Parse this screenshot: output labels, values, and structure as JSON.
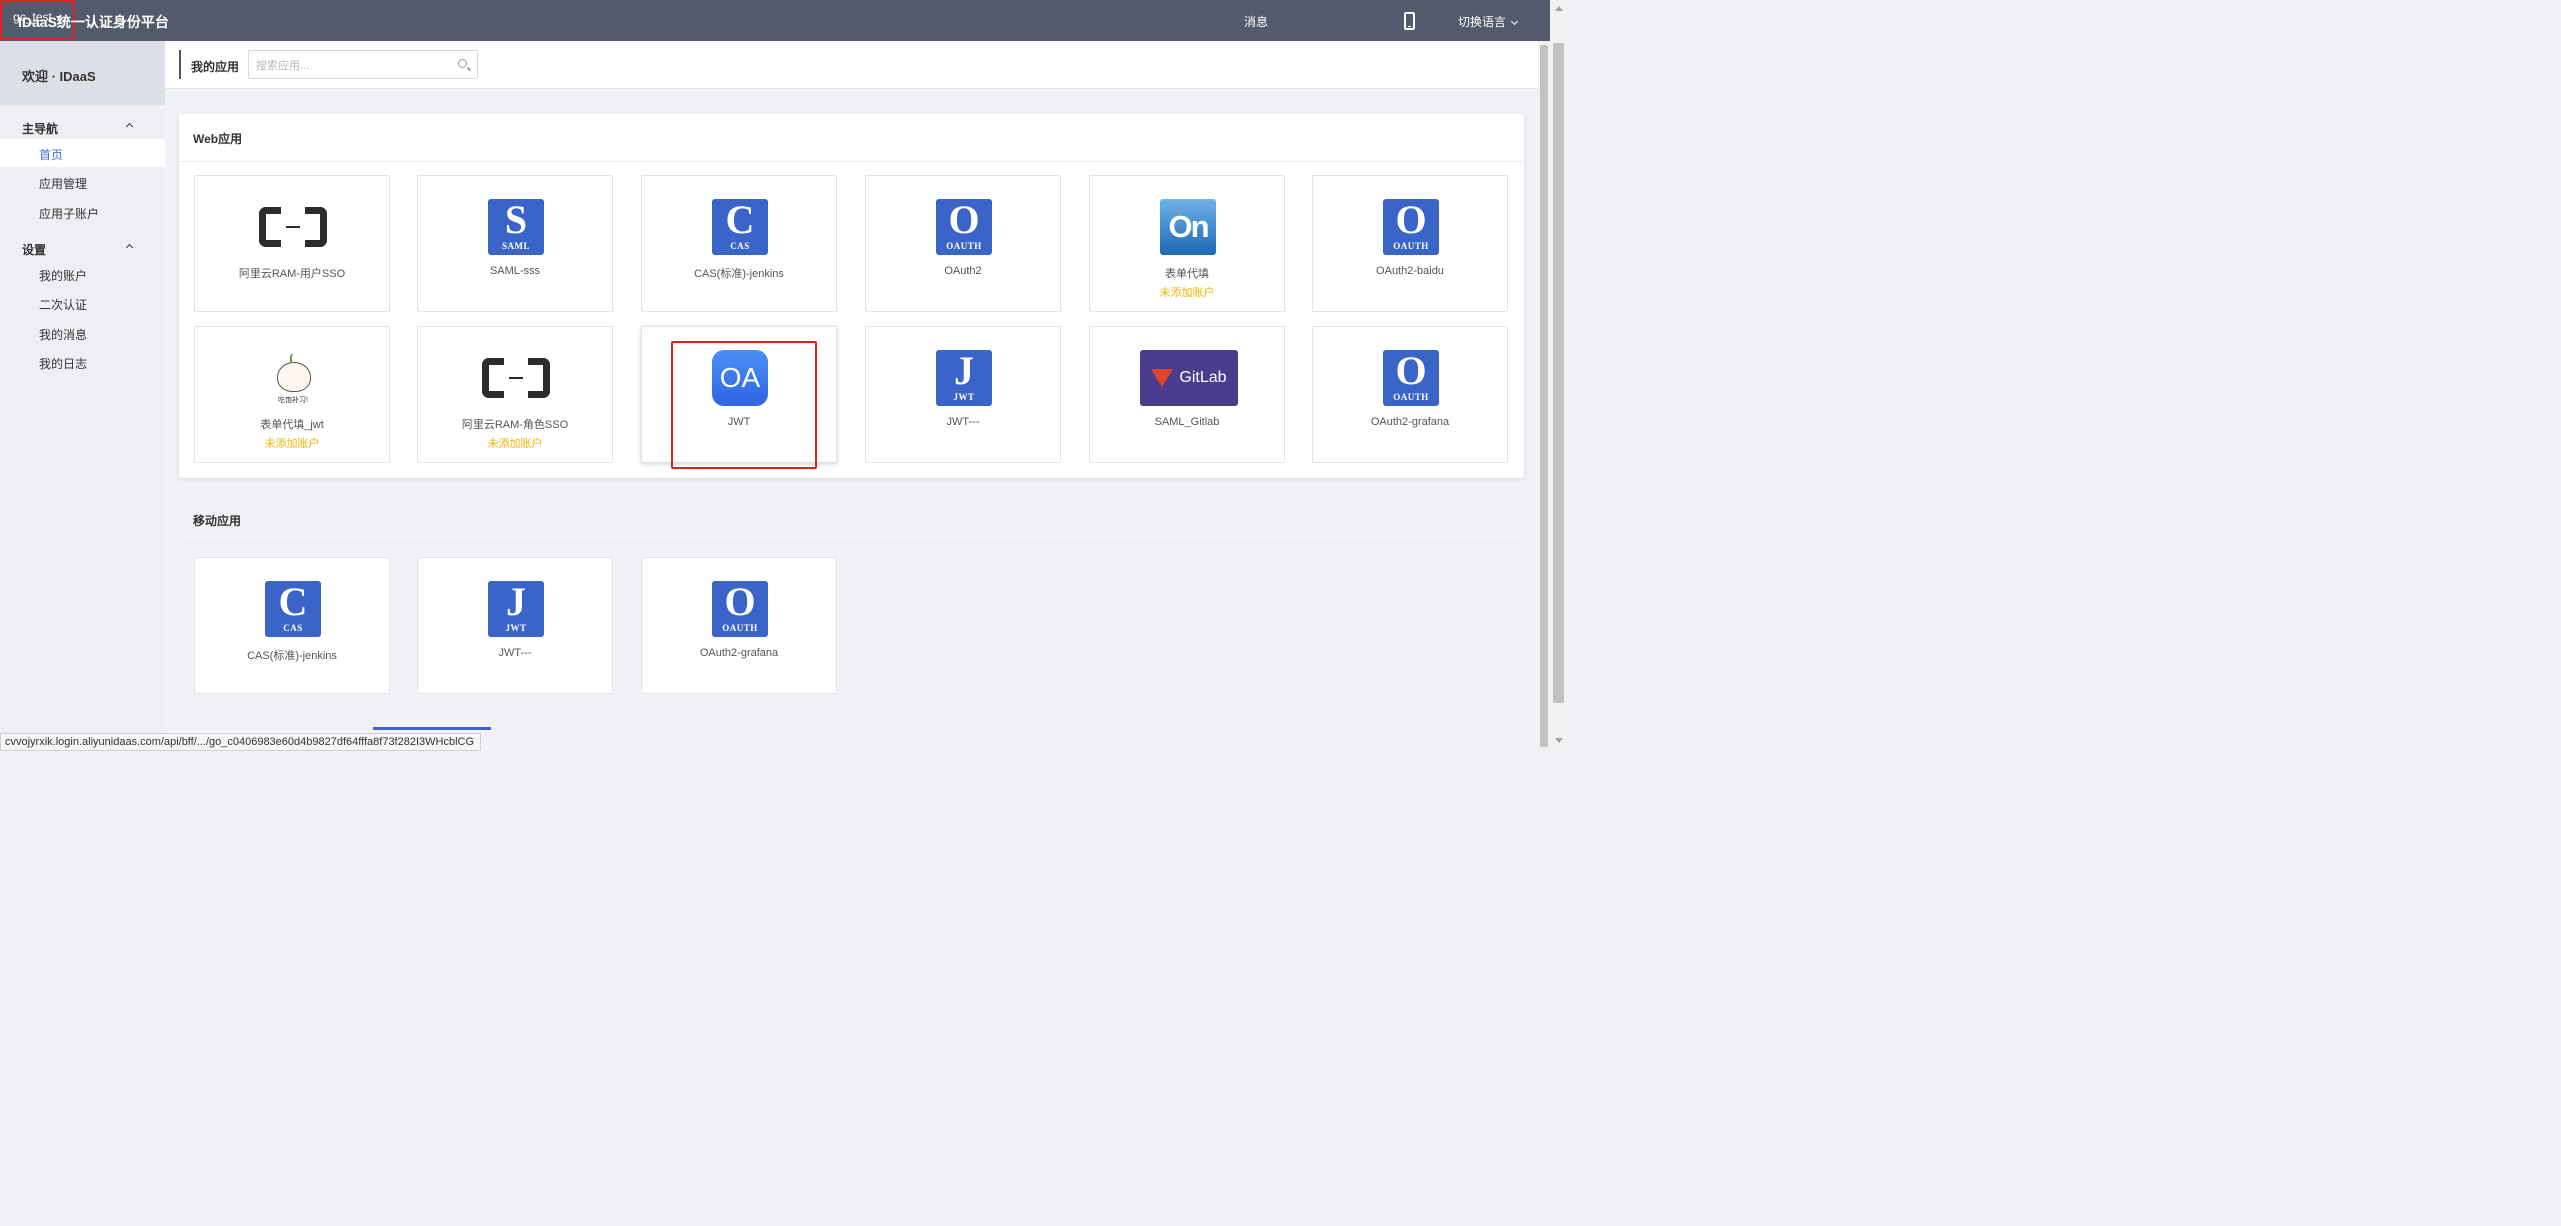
{
  "header": {
    "brand": "IDaaS统一认证身份平台",
    "messages": "消息",
    "user": "gc_test",
    "language": "切换语言"
  },
  "sidebar": {
    "welcome": "欢迎 · IDaaS",
    "groups": [
      {
        "label": "主导航",
        "items": [
          {
            "label": "首页",
            "active": true
          },
          {
            "label": "应用管理"
          },
          {
            "label": "应用子账户"
          }
        ]
      },
      {
        "label": "设置",
        "items": [
          {
            "label": "我的账户"
          },
          {
            "label": "二次认证"
          },
          {
            "label": "我的消息"
          },
          {
            "label": "我的日志"
          }
        ]
      }
    ]
  },
  "toolbar": {
    "title": "我的应用",
    "search_placeholder": "搜索应用..."
  },
  "web_apps": {
    "title": "Web应用",
    "items": [
      {
        "name": "阿里云RAM-用户SSO",
        "icon": "aliyun-logo-icon"
      },
      {
        "name": "SAML-sss",
        "icon": "saml-icon",
        "letter": "S",
        "tag": "SAML"
      },
      {
        "name": "CAS(标准)-jenkins",
        "icon": "cas-icon",
        "letter": "C",
        "tag": "CAS"
      },
      {
        "name": "OAuth2",
        "icon": "oauth-icon",
        "letter": "O",
        "tag": "OAUTH"
      },
      {
        "name": "表单代填",
        "icon": "form-fill-icon",
        "glyph": "On",
        "status": "未添加账户"
      },
      {
        "name": "OAuth2-baidu",
        "icon": "oauth-icon",
        "letter": "O",
        "tag": "OAUTH"
      },
      {
        "name": "表单代填_jwt",
        "icon": "mascot-icon",
        "caption": "吃饱补习!",
        "status": "未添加账户"
      },
      {
        "name": "阿里云RAM-角色SSO",
        "icon": "aliyun-logo-icon",
        "status": "未添加账户"
      },
      {
        "name": "JWT",
        "icon": "oa-icon",
        "glyph": "OA"
      },
      {
        "name": "JWT---",
        "icon": "jwt-icon",
        "letter": "J",
        "tag": "JWT"
      },
      {
        "name": "SAML_Gitlab",
        "icon": "gitlab-icon",
        "glyph": "GitLab"
      },
      {
        "name": "OAuth2-grafana",
        "icon": "oauth-icon",
        "letter": "O",
        "tag": "OAUTH"
      }
    ]
  },
  "mobile_apps": {
    "title": "移动应用",
    "items": [
      {
        "name": "CAS(标准)-jenkins",
        "icon": "cas-icon",
        "letter": "C",
        "tag": "CAS"
      },
      {
        "name": "JWT---",
        "icon": "jwt-icon",
        "letter": "J",
        "tag": "JWT"
      },
      {
        "name": "OAuth2-grafana",
        "icon": "oauth-icon",
        "letter": "O",
        "tag": "OAUTH"
      }
    ]
  },
  "status_bar_url": "cvvojyrxik.login.aliyunidaas.com/api/bff/.../go_c0406983e60d4b9827df64fffa8f73f282I3WHcblCG",
  "colors": {
    "topbar": "#535a6b",
    "accent": "#3a64c8",
    "warning": "#f0b400",
    "highlight": "#e02020"
  }
}
